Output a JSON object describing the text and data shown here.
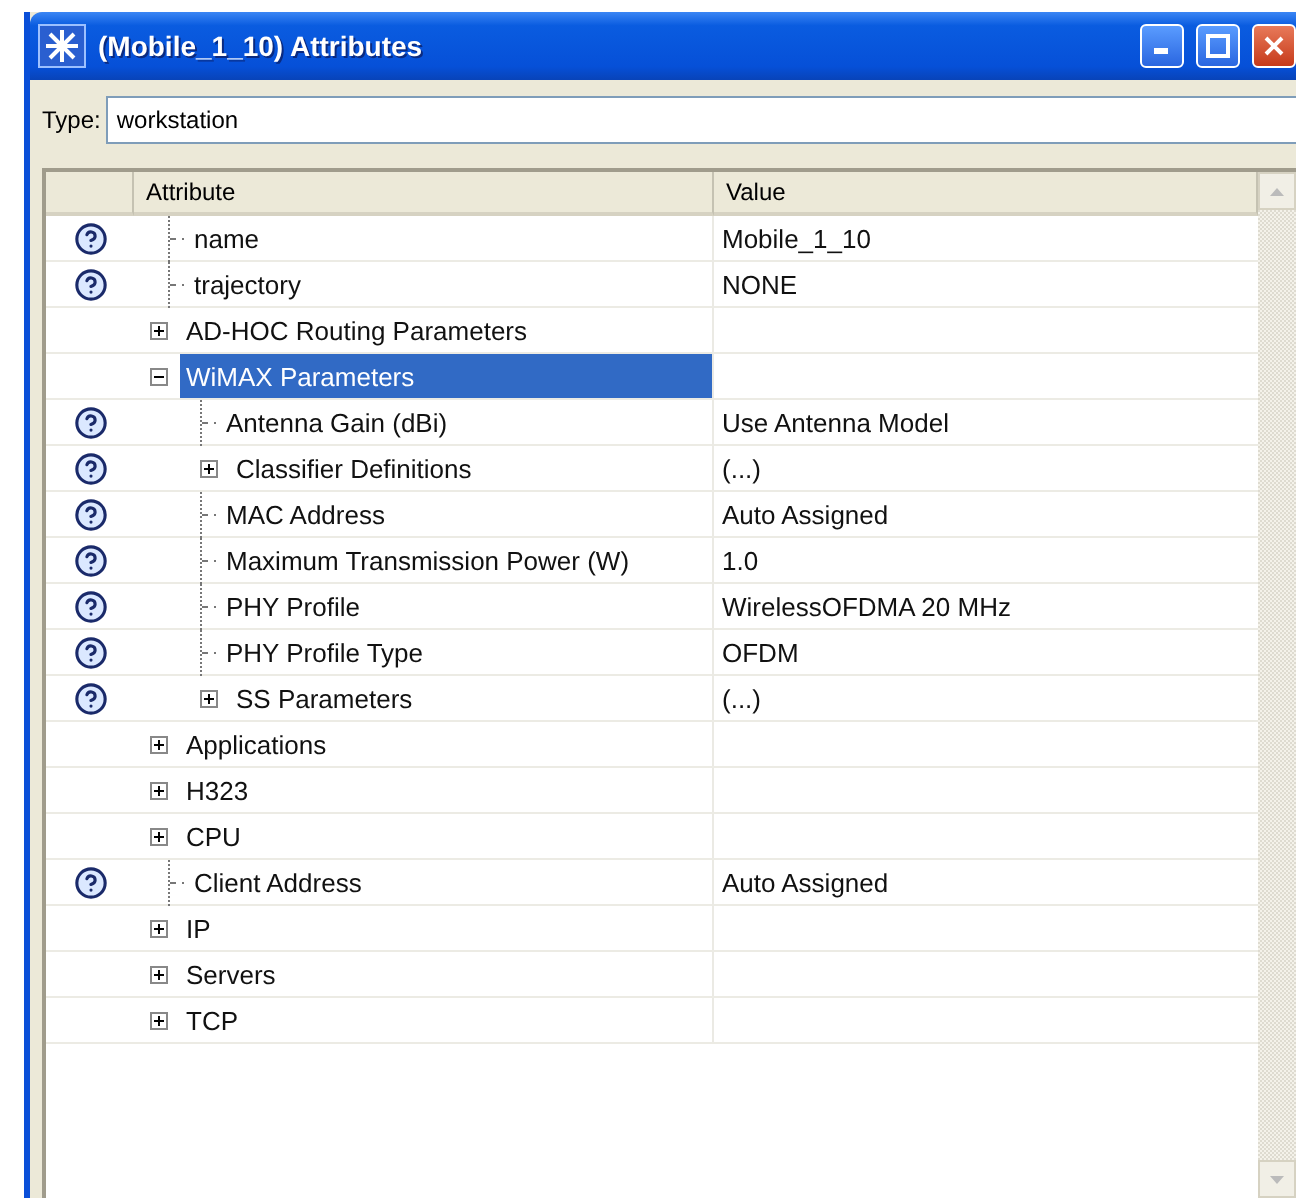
{
  "window": {
    "title": "(Mobile_1_10) Attributes"
  },
  "type_field": {
    "label": "Type:",
    "value": "workstation"
  },
  "table": {
    "columns": [
      "Attribute",
      "Value"
    ],
    "rows": [
      {
        "kind": "leaf",
        "label": "name",
        "value": "Mobile_1_10",
        "help": true,
        "selected": false
      },
      {
        "kind": "leaf",
        "label": "trajectory",
        "value": "NONE",
        "help": true,
        "selected": false
      },
      {
        "kind": "group",
        "label": "AD-HOC Routing Parameters",
        "help": false,
        "expanded": false,
        "selected": false
      },
      {
        "kind": "group",
        "label": "WiMAX Parameters",
        "help": false,
        "expanded": true,
        "selected": true,
        "children": [
          {
            "kind": "leaf",
            "label": "Antenna Gain (dBi)",
            "value": "Use Antenna Model",
            "help": true,
            "selected": false
          },
          {
            "kind": "group",
            "label": "Classifier Definitions",
            "value": "(...)",
            "help": true,
            "expanded": false,
            "selected": false
          },
          {
            "kind": "leaf",
            "label": "MAC Address",
            "value": "Auto Assigned",
            "help": true,
            "selected": false
          },
          {
            "kind": "leaf",
            "label": "Maximum Transmission Power (W)",
            "value": "1.0",
            "help": true,
            "selected": false
          },
          {
            "kind": "leaf",
            "label": "PHY Profile",
            "value": "WirelessOFDMA 20 MHz",
            "help": true,
            "selected": false
          },
          {
            "kind": "leaf",
            "label": "PHY Profile Type",
            "value": "OFDM",
            "help": true,
            "selected": false
          },
          {
            "kind": "group",
            "label": "SS Parameters",
            "value": "(...)",
            "help": true,
            "expanded": false,
            "selected": false
          }
        ]
      },
      {
        "kind": "group",
        "label": "Applications",
        "help": false,
        "expanded": false,
        "selected": false
      },
      {
        "kind": "group",
        "label": "H323",
        "help": false,
        "expanded": false,
        "selected": false
      },
      {
        "kind": "group",
        "label": "CPU",
        "help": false,
        "expanded": false,
        "selected": false
      },
      {
        "kind": "leaf",
        "label": "Client Address",
        "value": "Auto Assigned",
        "help": true,
        "selected": false
      },
      {
        "kind": "group",
        "label": "IP",
        "help": false,
        "expanded": false,
        "selected": false
      },
      {
        "kind": "group",
        "label": "Servers",
        "help": false,
        "expanded": false,
        "selected": false
      },
      {
        "kind": "group",
        "label": "TCP",
        "help": false,
        "expanded": false,
        "selected": false
      }
    ]
  }
}
